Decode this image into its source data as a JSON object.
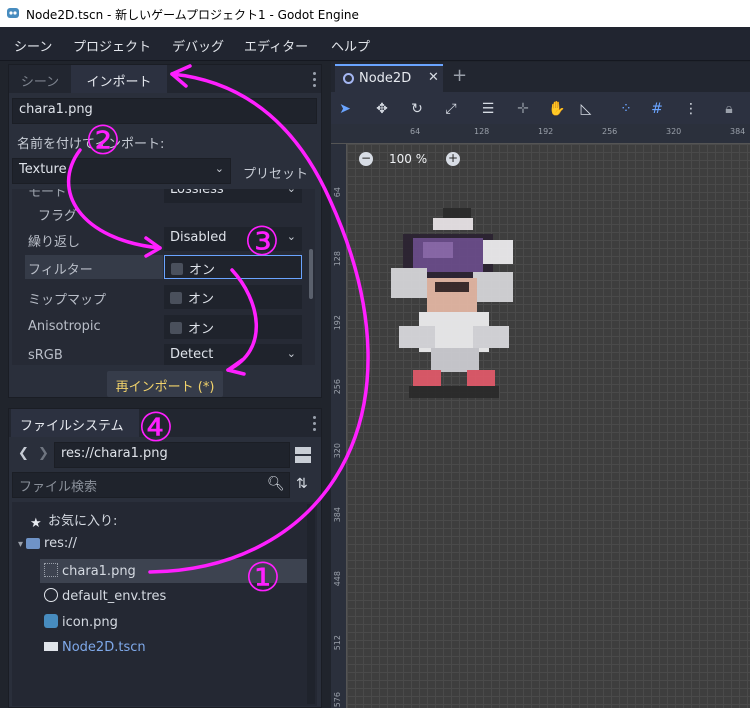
{
  "window": {
    "title": "Node2D.tscn - 新しいゲームプロジェクト1 - Godot Engine"
  },
  "menu": [
    "シーン",
    "プロジェクト",
    "デバッグ",
    "エディター",
    "ヘルプ"
  ],
  "import_dock": {
    "tabs": [
      "シーン",
      "インポート"
    ],
    "file": "chara1.png",
    "import_as_label": "名前を付けてインポート:",
    "import_as_value": "Texture",
    "preset_label": "プリセット",
    "cut_top_label": "モード",
    "cut_top_value": "Lossless",
    "section": "フラグ",
    "properties": [
      {
        "label": "繰り返し",
        "value": "Disabled",
        "type": "select"
      },
      {
        "label": "フィルター",
        "value": "オン",
        "type": "check"
      },
      {
        "label": "ミップマップ",
        "value": "オン",
        "type": "check"
      },
      {
        "label": "Anisotropic",
        "value": "オン",
        "type": "check"
      },
      {
        "label": "sRGB",
        "value": "Detect",
        "type": "select"
      }
    ],
    "reimport_button": "再インポート (*)"
  },
  "filesystem_dock": {
    "title": "ファイルシステム",
    "path": "res://chara1.png",
    "search_placeholder": "ファイル検索",
    "items": [
      {
        "label": "お気に入り:",
        "icon": "star-icon"
      },
      {
        "label": "res://",
        "icon": "folder-icon"
      },
      {
        "label": "chara1.png",
        "icon": "image-file-icon"
      },
      {
        "label": "default_env.tres",
        "icon": "globe-icon"
      },
      {
        "label": "icon.png",
        "icon": "godot-icon"
      },
      {
        "label": "Node2D.tscn",
        "icon": "scene-icon"
      }
    ]
  },
  "viewport": {
    "scene_tab": "Node2D",
    "zoom": "100 %",
    "ruler_top": [
      "64",
      "128",
      "192",
      "256",
      "320",
      "384"
    ],
    "ruler_left": [
      "64",
      "128",
      "192",
      "256",
      "320",
      "384",
      "448",
      "512",
      "576"
    ]
  },
  "annotations": [
    "②",
    "③",
    "④",
    "①"
  ],
  "colors": {
    "annotation": "#ff1fff",
    "accent": "#6aa4ff"
  }
}
